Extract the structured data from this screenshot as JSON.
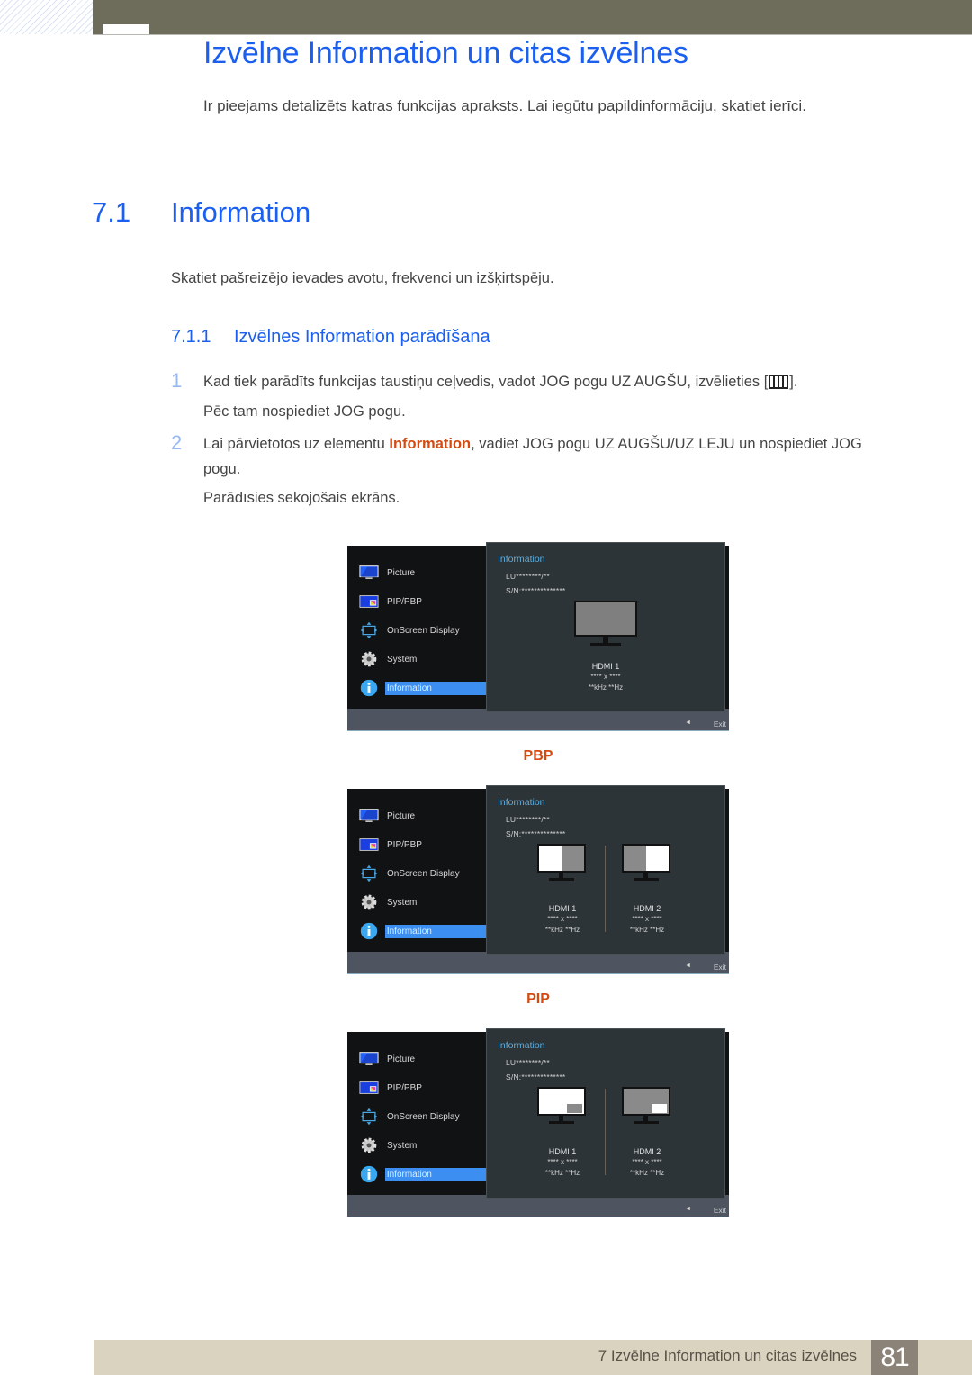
{
  "header": {
    "title": "Izvēlne Information un citas izvēlnes",
    "intro": "Ir pieejams detalizēts katras funkcijas apraksts. Lai iegūtu papildinformāciju, skatiet ierīci."
  },
  "section": {
    "number": "7.1",
    "title": "Information",
    "description": "Skatiet pašreizējo ievades avotu, frekvenci un izšķirtspēju."
  },
  "subsection": {
    "number": "7.1.1",
    "title": "Izvēlnes Information parādīšana"
  },
  "steps": [
    {
      "number": "1",
      "line1_before_icon": "Kad tiek parādīts funkcijas taustiņu ceļvedis, vadot JOG pogu UZ AUGŠU, izvēlieties [",
      "line1_after_icon": "].",
      "icon": "jog-menu-icon",
      "line2": "Pēc tam nospiediet JOG pogu."
    },
    {
      "number": "2",
      "line1_before": "Lai pārvietotos uz elementu ",
      "highlight": "Information",
      "line1_after": ", vadiet JOG pogu UZ AUGŠU/UZ LEJU un nospiediet JOG",
      "line2": "pogu.",
      "line3": "Parādīsies sekojošais ekrāns."
    }
  ],
  "osd": {
    "menu": [
      {
        "label": "Picture",
        "icon": "picture-icon"
      },
      {
        "label": "PIP/PBP",
        "icon": "pip-pbp-icon"
      },
      {
        "label": "OnScreen Display",
        "icon": "onscreen-display-icon"
      },
      {
        "label": "System",
        "icon": "gear-icon"
      },
      {
        "label": "Information",
        "icon": "info-icon",
        "selected": true
      }
    ],
    "panel_title": "Information",
    "model": "LU********/**",
    "serial": "S/N:**************",
    "back_icon": "◄",
    "exit_label": "Exit",
    "sources": {
      "single": [
        {
          "name": "HDMI 1",
          "resolution": "**** x ****",
          "frequency": "**kHz **Hz"
        }
      ],
      "pbp": [
        {
          "name": "HDMI 1",
          "resolution": "**** x ****",
          "frequency": "**kHz **Hz"
        },
        {
          "name": "HDMI 2",
          "resolution": "**** x ****",
          "frequency": "**kHz **Hz"
        }
      ],
      "pip": [
        {
          "name": "HDMI 1",
          "resolution": "**** x ****",
          "frequency": "**kHz **Hz"
        },
        {
          "name": "HDMI 2",
          "resolution": "**** x ****",
          "frequency": "**kHz **Hz"
        }
      ]
    }
  },
  "modes": {
    "pbp": "PBP",
    "pip": "PIP"
  },
  "footer": {
    "chapter": "7 Izvēlne Information un citas izvēlnes",
    "page": "81"
  }
}
